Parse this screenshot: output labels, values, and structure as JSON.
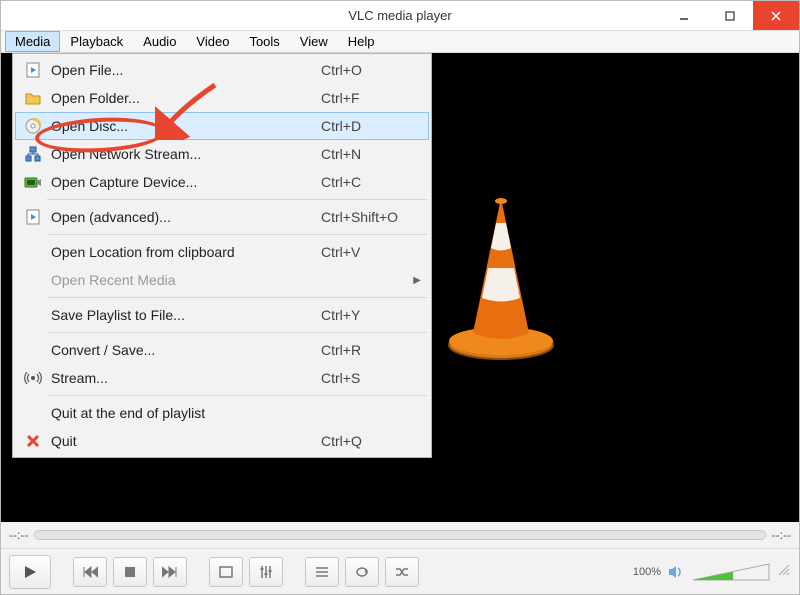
{
  "titlebar": {
    "title": "VLC media player"
  },
  "menubar": {
    "items": [
      "Media",
      "Playback",
      "Audio",
      "Video",
      "Tools",
      "View",
      "Help"
    ],
    "activeIndex": 0
  },
  "dropdown": {
    "items": [
      {
        "icon": "play-doc-icon",
        "label": "Open File...",
        "shortcut": "Ctrl+O"
      },
      {
        "icon": "folder-icon",
        "label": "Open Folder...",
        "shortcut": "Ctrl+F"
      },
      {
        "icon": "disc-icon",
        "label": "Open Disc...",
        "shortcut": "Ctrl+D",
        "highlight": true
      },
      {
        "icon": "network-icon",
        "label": "Open Network Stream...",
        "shortcut": "Ctrl+N"
      },
      {
        "icon": "capture-icon",
        "label": "Open Capture Device...",
        "shortcut": "Ctrl+C"
      },
      {
        "sep": true
      },
      {
        "icon": "play-doc-icon",
        "label": "Open (advanced)...",
        "shortcut": "Ctrl+Shift+O"
      },
      {
        "sep": true
      },
      {
        "icon": "",
        "label": "Open Location from clipboard",
        "shortcut": "Ctrl+V"
      },
      {
        "icon": "",
        "label": "Open Recent Media",
        "shortcut": "",
        "submenu": true,
        "disabled": true
      },
      {
        "sep": true
      },
      {
        "icon": "",
        "label": "Save Playlist to File...",
        "shortcut": "Ctrl+Y"
      },
      {
        "sep": true
      },
      {
        "icon": "",
        "label": "Convert / Save...",
        "shortcut": "Ctrl+R"
      },
      {
        "icon": "stream-icon",
        "label": "Stream...",
        "shortcut": "Ctrl+S"
      },
      {
        "sep": true
      },
      {
        "icon": "",
        "label": "Quit at the end of playlist",
        "shortcut": ""
      },
      {
        "icon": "quit-icon",
        "label": "Quit",
        "shortcut": "Ctrl+Q"
      }
    ]
  },
  "seekbar": {
    "time_left": "--:--",
    "time_right": "--:--"
  },
  "controls": {
    "volume_label": "100%"
  }
}
